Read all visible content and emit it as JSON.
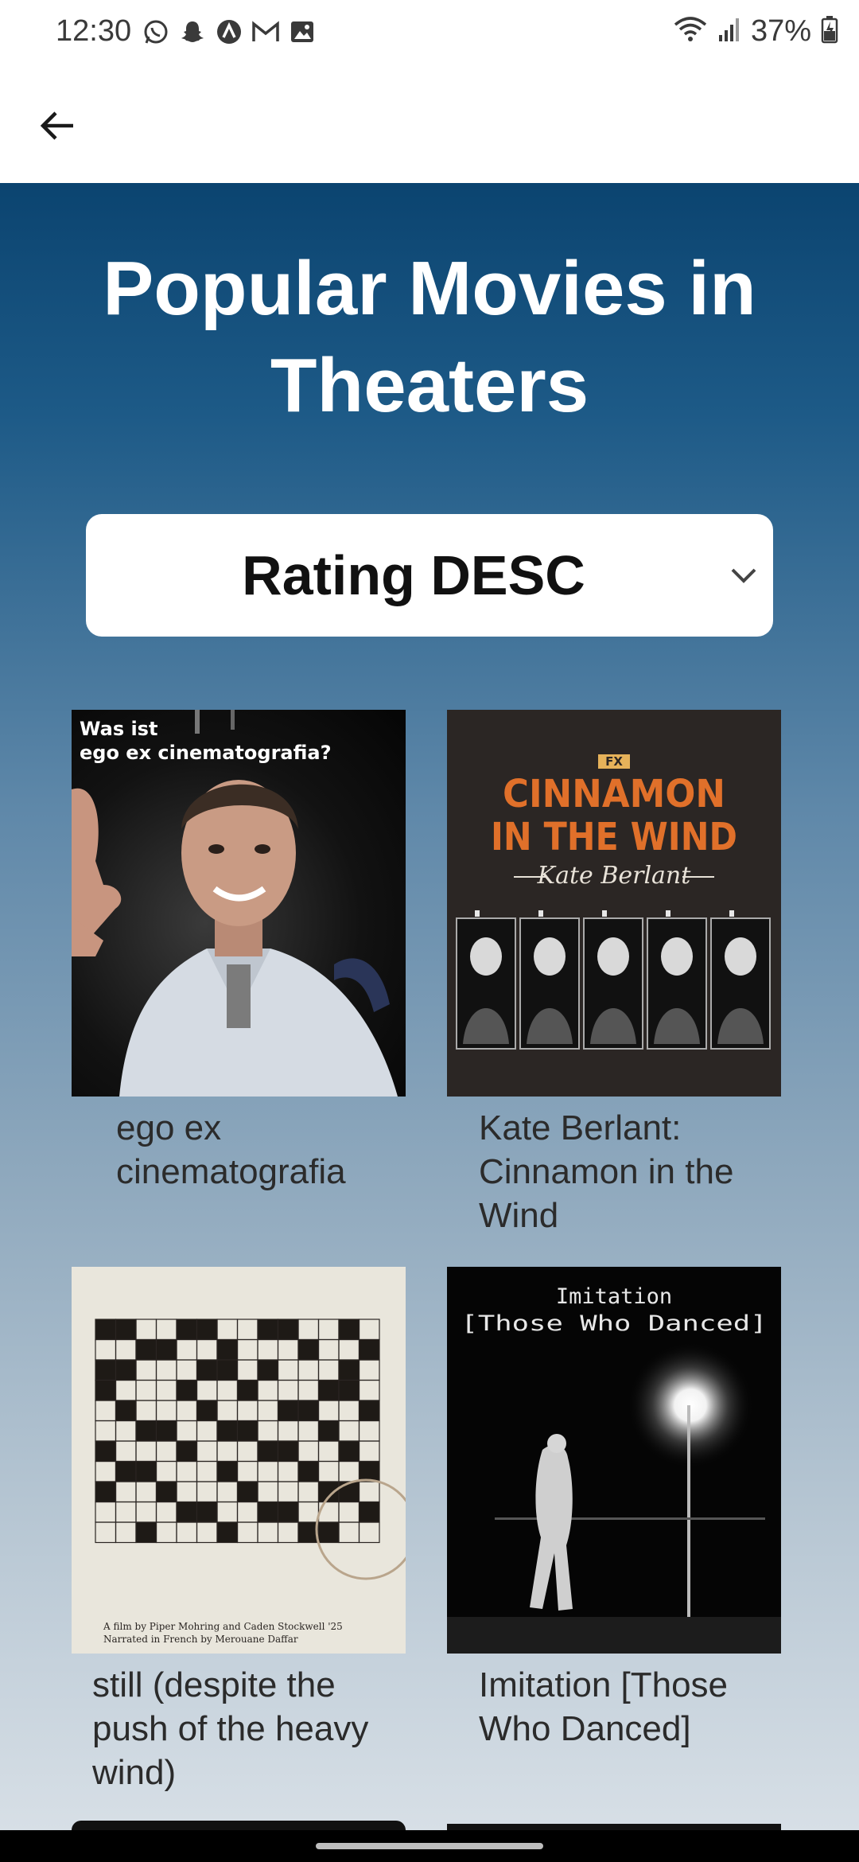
{
  "status_bar": {
    "time": "12:30",
    "battery": "37%",
    "left_icons": [
      "whatsapp-icon",
      "snapchat-icon",
      "app-icon",
      "gmail-icon",
      "gallery-icon"
    ],
    "right_icons": [
      "wifi-icon",
      "signal-icon",
      "battery-icon"
    ]
  },
  "app_bar": {
    "back_icon": "arrow-left-icon"
  },
  "page": {
    "title": "Popular Movies in Theaters",
    "sort": {
      "selected": "Rating DESC",
      "icon": "chevron-down-icon"
    }
  },
  "movies": [
    {
      "title": "ego ex cinematografia",
      "poster_text": "Was ist\nego ex cinematografia?"
    },
    {
      "title": "Kate Berlant: Cinnamon in the Wind",
      "poster_badge": "FX",
      "poster_title": "CINNAMON\nIN THE WIND",
      "poster_subtitle": "Kate Berlant"
    },
    {
      "title": "still (despite the push of the heavy wind)",
      "poster_credits": "A film by Piper Mohring and Caden Stockwell '25\nNarrated in French by Merouane Daffar"
    },
    {
      "title": "Imitation [Those Who Danced]",
      "poster_text": "Imitation\n[Those Who Danced]"
    }
  ],
  "colors": {
    "gradient_top": "#0b4470",
    "gradient_bottom": "#d7dfe6",
    "poster_orange": "#e0702a"
  }
}
